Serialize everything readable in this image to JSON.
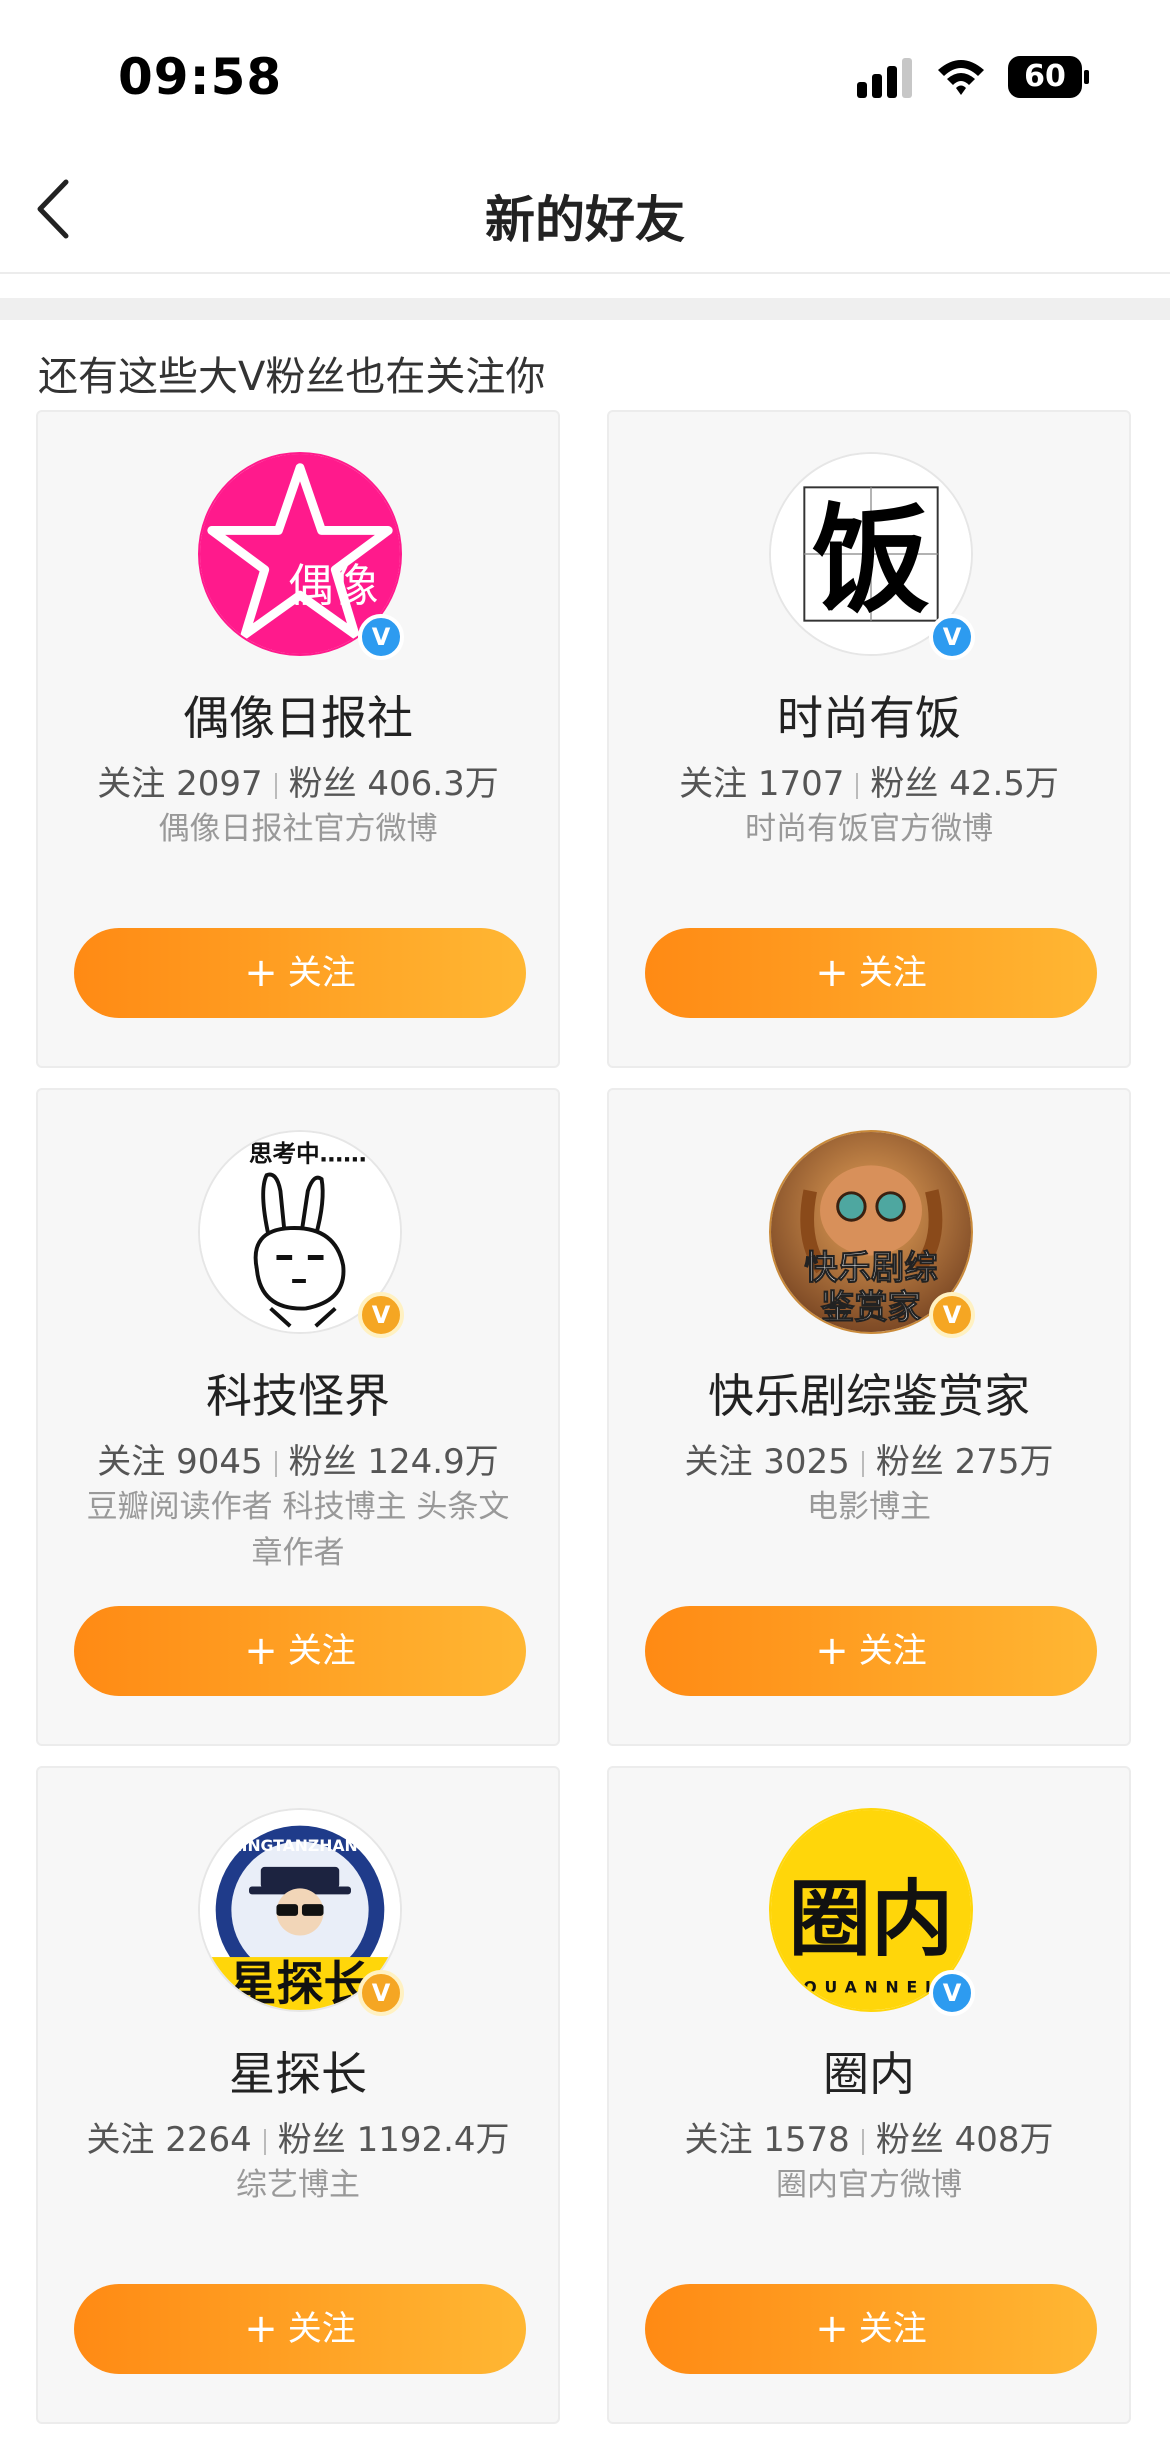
{
  "status": {
    "time": "09:58",
    "battery": "60"
  },
  "nav": {
    "title": "新的好友"
  },
  "section": {
    "title": "还有这些大V粉丝也在关注你"
  },
  "cards": [
    {
      "name": "偶像日报社",
      "follow_label": "关注",
      "follow_count": "2097",
      "fans_label": "粉丝",
      "fans_count": "406.3万",
      "desc": "偶像日报社官方微博",
      "button": "关注",
      "avatar_text": "偶像",
      "badge": "V",
      "badge_color": "#2d9bf0"
    },
    {
      "name": "时尚有饭",
      "follow_label": "关注",
      "follow_count": "1707",
      "fans_label": "粉丝",
      "fans_count": "42.5万",
      "desc": "时尚有饭官方微博",
      "button": "关注",
      "avatar_text": "饭",
      "badge": "V",
      "badge_color": "#2d9bf0"
    },
    {
      "name": "科技怪界",
      "follow_label": "关注",
      "follow_count": "9045",
      "fans_label": "粉丝",
      "fans_count": "124.9万",
      "desc": "豆瓣阅读作者 科技博主 头条文章作者",
      "button": "关注",
      "avatar_text": "思考中……",
      "badge": "V",
      "badge_color": "#f5a623"
    },
    {
      "name": "快乐剧综鉴赏家",
      "follow_label": "关注",
      "follow_count": "3025",
      "fans_label": "粉丝",
      "fans_count": "275万",
      "desc": "电影博主",
      "button": "关注",
      "avatar_text_1": "快乐剧综",
      "avatar_text_2": "鉴赏家",
      "badge": "V",
      "badge_color": "#f5a623"
    },
    {
      "name": "星探长",
      "follow_label": "关注",
      "follow_count": "2264",
      "fans_label": "粉丝",
      "fans_count": "1192.4万",
      "desc": "综艺博主",
      "button": "关注",
      "avatar_text": "星探长",
      "avatar_arc": "XINGTANZHANG",
      "badge": "V",
      "badge_color": "#f5a623"
    },
    {
      "name": "圈内",
      "follow_label": "关注",
      "follow_count": "1578",
      "fans_label": "粉丝",
      "fans_count": "408万",
      "desc": "圈内官方微博",
      "button": "关注",
      "avatar_text": "圈内",
      "avatar_arc": "QUANNEI",
      "badge": "V",
      "badge_color": "#2d9bf0"
    }
  ],
  "colors": {
    "accent_start": "#ff8a14",
    "accent_end": "#ffb733",
    "verified_blue": "#2d9bf0",
    "verified_orange": "#f5a623"
  }
}
